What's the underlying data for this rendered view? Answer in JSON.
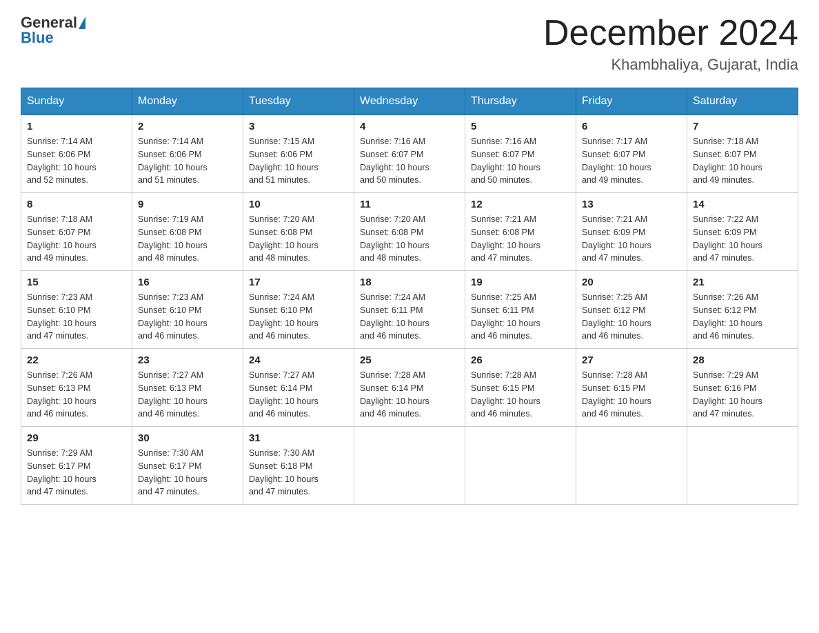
{
  "header": {
    "logo_general": "General",
    "logo_blue": "Blue",
    "month_title": "December 2024",
    "location": "Khambhaliya, Gujarat, India"
  },
  "days_of_week": [
    "Sunday",
    "Monday",
    "Tuesday",
    "Wednesday",
    "Thursday",
    "Friday",
    "Saturday"
  ],
  "weeks": [
    [
      {
        "day": "1",
        "sunrise": "7:14 AM",
        "sunset": "6:06 PM",
        "daylight": "10 hours and 52 minutes."
      },
      {
        "day": "2",
        "sunrise": "7:14 AM",
        "sunset": "6:06 PM",
        "daylight": "10 hours and 51 minutes."
      },
      {
        "day": "3",
        "sunrise": "7:15 AM",
        "sunset": "6:06 PM",
        "daylight": "10 hours and 51 minutes."
      },
      {
        "day": "4",
        "sunrise": "7:16 AM",
        "sunset": "6:07 PM",
        "daylight": "10 hours and 50 minutes."
      },
      {
        "day": "5",
        "sunrise": "7:16 AM",
        "sunset": "6:07 PM",
        "daylight": "10 hours and 50 minutes."
      },
      {
        "day": "6",
        "sunrise": "7:17 AM",
        "sunset": "6:07 PM",
        "daylight": "10 hours and 49 minutes."
      },
      {
        "day": "7",
        "sunrise": "7:18 AM",
        "sunset": "6:07 PM",
        "daylight": "10 hours and 49 minutes."
      }
    ],
    [
      {
        "day": "8",
        "sunrise": "7:18 AM",
        "sunset": "6:07 PM",
        "daylight": "10 hours and 49 minutes."
      },
      {
        "day": "9",
        "sunrise": "7:19 AM",
        "sunset": "6:08 PM",
        "daylight": "10 hours and 48 minutes."
      },
      {
        "day": "10",
        "sunrise": "7:20 AM",
        "sunset": "6:08 PM",
        "daylight": "10 hours and 48 minutes."
      },
      {
        "day": "11",
        "sunrise": "7:20 AM",
        "sunset": "6:08 PM",
        "daylight": "10 hours and 48 minutes."
      },
      {
        "day": "12",
        "sunrise": "7:21 AM",
        "sunset": "6:08 PM",
        "daylight": "10 hours and 47 minutes."
      },
      {
        "day": "13",
        "sunrise": "7:21 AM",
        "sunset": "6:09 PM",
        "daylight": "10 hours and 47 minutes."
      },
      {
        "day": "14",
        "sunrise": "7:22 AM",
        "sunset": "6:09 PM",
        "daylight": "10 hours and 47 minutes."
      }
    ],
    [
      {
        "day": "15",
        "sunrise": "7:23 AM",
        "sunset": "6:10 PM",
        "daylight": "10 hours and 47 minutes."
      },
      {
        "day": "16",
        "sunrise": "7:23 AM",
        "sunset": "6:10 PM",
        "daylight": "10 hours and 46 minutes."
      },
      {
        "day": "17",
        "sunrise": "7:24 AM",
        "sunset": "6:10 PM",
        "daylight": "10 hours and 46 minutes."
      },
      {
        "day": "18",
        "sunrise": "7:24 AM",
        "sunset": "6:11 PM",
        "daylight": "10 hours and 46 minutes."
      },
      {
        "day": "19",
        "sunrise": "7:25 AM",
        "sunset": "6:11 PM",
        "daylight": "10 hours and 46 minutes."
      },
      {
        "day": "20",
        "sunrise": "7:25 AM",
        "sunset": "6:12 PM",
        "daylight": "10 hours and 46 minutes."
      },
      {
        "day": "21",
        "sunrise": "7:26 AM",
        "sunset": "6:12 PM",
        "daylight": "10 hours and 46 minutes."
      }
    ],
    [
      {
        "day": "22",
        "sunrise": "7:26 AM",
        "sunset": "6:13 PM",
        "daylight": "10 hours and 46 minutes."
      },
      {
        "day": "23",
        "sunrise": "7:27 AM",
        "sunset": "6:13 PM",
        "daylight": "10 hours and 46 minutes."
      },
      {
        "day": "24",
        "sunrise": "7:27 AM",
        "sunset": "6:14 PM",
        "daylight": "10 hours and 46 minutes."
      },
      {
        "day": "25",
        "sunrise": "7:28 AM",
        "sunset": "6:14 PM",
        "daylight": "10 hours and 46 minutes."
      },
      {
        "day": "26",
        "sunrise": "7:28 AM",
        "sunset": "6:15 PM",
        "daylight": "10 hours and 46 minutes."
      },
      {
        "day": "27",
        "sunrise": "7:28 AM",
        "sunset": "6:15 PM",
        "daylight": "10 hours and 46 minutes."
      },
      {
        "day": "28",
        "sunrise": "7:29 AM",
        "sunset": "6:16 PM",
        "daylight": "10 hours and 47 minutes."
      }
    ],
    [
      {
        "day": "29",
        "sunrise": "7:29 AM",
        "sunset": "6:17 PM",
        "daylight": "10 hours and 47 minutes."
      },
      {
        "day": "30",
        "sunrise": "7:30 AM",
        "sunset": "6:17 PM",
        "daylight": "10 hours and 47 minutes."
      },
      {
        "day": "31",
        "sunrise": "7:30 AM",
        "sunset": "6:18 PM",
        "daylight": "10 hours and 47 minutes."
      },
      null,
      null,
      null,
      null
    ]
  ],
  "labels": {
    "sunrise": "Sunrise:",
    "sunset": "Sunset:",
    "daylight": "Daylight:"
  }
}
